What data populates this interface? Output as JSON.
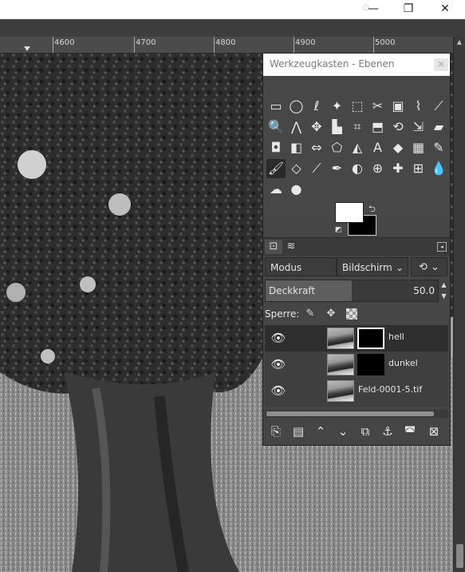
{
  "window": {
    "minimize_icon": "minimize-icon",
    "restore_icon": "restore-icon",
    "close_icon": "close-icon",
    "minimize_glyph": "—",
    "restore_glyph": "❐",
    "close_glyph": "✕"
  },
  "ruler": {
    "labels": [
      "4600",
      "4700",
      "4800",
      "4900",
      "5000"
    ]
  },
  "dock": {
    "title": "Werkzeugkasten - Ebenen",
    "close_glyph": "✕"
  },
  "tools": [
    {
      "name": "rect-select-icon",
      "glyph": "▭"
    },
    {
      "name": "ellipse-select-icon",
      "glyph": "◯"
    },
    {
      "name": "free-select-icon",
      "glyph": "ℓ"
    },
    {
      "name": "fuzzy-select-icon",
      "glyph": "✦"
    },
    {
      "name": "color-select-icon",
      "glyph": "⬚"
    },
    {
      "name": "scissors-icon",
      "glyph": "✂"
    },
    {
      "name": "foreground-select-icon",
      "glyph": "▣"
    },
    {
      "name": "paths-icon",
      "glyph": "⌇"
    },
    {
      "name": "color-picker-icon",
      "glyph": "⟋"
    },
    {
      "name": "zoom-icon",
      "glyph": "🔍"
    },
    {
      "name": "measure-icon",
      "glyph": "⋀"
    },
    {
      "name": "move-icon",
      "glyph": "✥"
    },
    {
      "name": "align-icon",
      "glyph": "▙"
    },
    {
      "name": "crop-icon",
      "glyph": "⌗"
    },
    {
      "name": "unified-transform-icon",
      "glyph": "⬒"
    },
    {
      "name": "rotate-icon",
      "glyph": "⟲"
    },
    {
      "name": "scale-icon",
      "glyph": "⇲"
    },
    {
      "name": "shear-icon",
      "glyph": "▰"
    },
    {
      "name": "warp-icon",
      "glyph": "◘"
    },
    {
      "name": "perspective-icon",
      "glyph": "◧"
    },
    {
      "name": "flip-icon",
      "glyph": "⇔"
    },
    {
      "name": "cage-icon",
      "glyph": "⬠"
    },
    {
      "name": "handle-transform-icon",
      "glyph": "◭"
    },
    {
      "name": "text-icon",
      "glyph": "A"
    },
    {
      "name": "bucket-fill-icon",
      "glyph": "◆"
    },
    {
      "name": "blend-icon",
      "glyph": "▦"
    },
    {
      "name": "pencil-icon",
      "glyph": "✎"
    },
    {
      "name": "paintbrush-icon",
      "glyph": "🖌"
    },
    {
      "name": "eraser-icon",
      "glyph": "◇"
    },
    {
      "name": "airbrush-icon",
      "glyph": "⟋"
    },
    {
      "name": "ink-icon",
      "glyph": "✒"
    },
    {
      "name": "mypaint-brush-icon",
      "glyph": "◐"
    },
    {
      "name": "clone-icon",
      "glyph": "⊕"
    },
    {
      "name": "heal-icon",
      "glyph": "✚"
    },
    {
      "name": "perspective-clone-icon",
      "glyph": "⊞"
    },
    {
      "name": "blur-icon",
      "glyph": "💧"
    },
    {
      "name": "smudge-icon",
      "glyph": "☁"
    },
    {
      "name": "dodge-burn-icon",
      "glyph": "●"
    }
  ],
  "layers_panel": {
    "mode_label": "Modus",
    "mode_value": "Bildschirm",
    "mode_chevron": "⌄",
    "reset_glyph": "⟲ ⌄",
    "opacity_label": "Deckkraft",
    "opacity_value": "50.0",
    "opacity_fraction": 0.5,
    "lock_label": "Sperre:",
    "layers": [
      {
        "name": "hell",
        "has_mask": true,
        "selected": true
      },
      {
        "name": "dunkel",
        "has_mask": true,
        "selected": false
      },
      {
        "name": "Feld-0001-5.tif",
        "has_mask": false,
        "selected": false
      }
    ]
  },
  "colors": {
    "foreground": "#ffffff",
    "background": "#000000"
  }
}
